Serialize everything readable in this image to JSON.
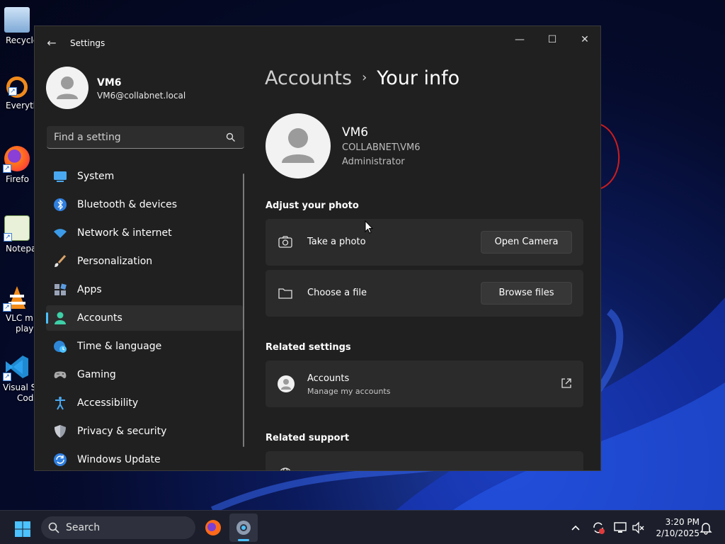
{
  "desktop": {
    "icons": [
      {
        "label": "Recycle",
        "icon": "recycle-bin-icon"
      },
      {
        "label": "Everyth",
        "icon": "everything-search-icon"
      },
      {
        "label": "Firefo",
        "icon": "firefox-icon"
      },
      {
        "label": "Notepa",
        "icon": "notepad-icon"
      },
      {
        "label": "VLC m",
        "label2": "playe",
        "icon": "vlc-icon"
      },
      {
        "label": "Visual St",
        "label2": "Cod",
        "icon": "vscode-icon"
      }
    ]
  },
  "window": {
    "title": "Settings",
    "controls": {
      "minimize": "—",
      "maximize": "☐",
      "close": "✕"
    }
  },
  "sidebar": {
    "profile": {
      "name": "VM6",
      "email": "VM6@collabnet.local"
    },
    "search_placeholder": "Find a setting",
    "items": [
      {
        "label": "System",
        "icon": "system-icon"
      },
      {
        "label": "Bluetooth & devices",
        "icon": "bluetooth-icon"
      },
      {
        "label": "Network & internet",
        "icon": "network-icon"
      },
      {
        "label": "Personalization",
        "icon": "brush-icon"
      },
      {
        "label": "Apps",
        "icon": "apps-icon"
      },
      {
        "label": "Accounts",
        "icon": "accounts-icon",
        "active": true
      },
      {
        "label": "Time & language",
        "icon": "globe-clock-icon"
      },
      {
        "label": "Gaming",
        "icon": "gamepad-icon"
      },
      {
        "label": "Accessibility",
        "icon": "accessibility-icon"
      },
      {
        "label": "Privacy & security",
        "icon": "shield-icon"
      },
      {
        "label": "Windows Update",
        "icon": "update-icon"
      }
    ]
  },
  "main": {
    "breadcrumb": {
      "parent": "Accounts",
      "separator": "›",
      "current": "Your info"
    },
    "user": {
      "name": "VM6",
      "domain": "COLLABNET\\VM6",
      "role": "Administrator"
    },
    "adjust_photo": {
      "title": "Adjust your photo",
      "take_photo": {
        "label": "Take a photo",
        "button": "Open Camera"
      },
      "choose_file": {
        "label": "Choose a file",
        "button": "Browse files"
      }
    },
    "related_settings": {
      "title": "Related settings",
      "accounts": {
        "title": "Accounts",
        "subtitle": "Manage my accounts"
      }
    },
    "related_support": {
      "title": "Related support"
    }
  },
  "taskbar": {
    "search_label": "Search",
    "clock": {
      "time": "3:20 PM",
      "date": "2/10/2025"
    }
  },
  "colors": {
    "accent": "#4cc2ff",
    "window_bg": "#202020",
    "card_bg": "#2b2b2b"
  }
}
